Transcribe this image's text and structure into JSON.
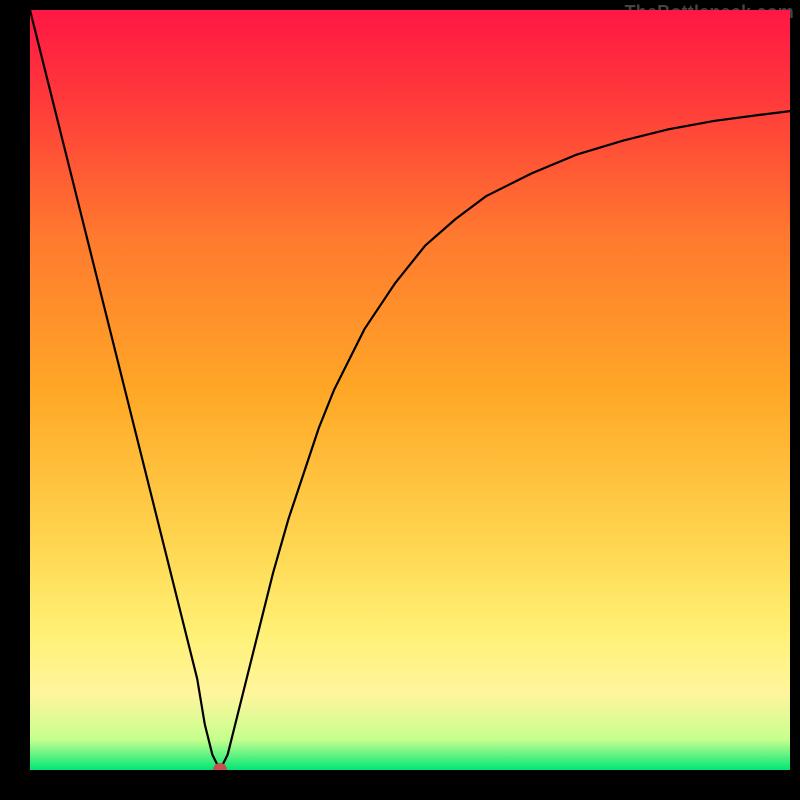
{
  "watermark": "TheBottleneck.com",
  "chart_data": {
    "type": "line",
    "title": "",
    "xlabel": "",
    "ylabel": "",
    "xlim": [
      0,
      100
    ],
    "ylim": [
      0,
      100
    ],
    "x": [
      0,
      2,
      4,
      6,
      8,
      10,
      12,
      14,
      16,
      18,
      20,
      22,
      23,
      24,
      25,
      26,
      28,
      30,
      32,
      34,
      36,
      38,
      40,
      44,
      48,
      52,
      56,
      60,
      66,
      72,
      78,
      84,
      90,
      96,
      100
    ],
    "values": [
      100,
      92,
      84,
      76,
      68,
      60,
      52,
      44,
      36,
      28,
      20,
      12,
      6,
      2,
      0,
      2,
      10,
      18,
      26,
      33,
      39,
      45,
      50,
      58,
      64,
      69,
      72.5,
      75.5,
      78.5,
      81,
      82.8,
      84.3,
      85.4,
      86.2,
      86.7
    ],
    "marker": {
      "x": 25,
      "y": 0,
      "color": "#c94f4f"
    },
    "gradient_stops": [
      {
        "offset": 0.0,
        "color": "#ff1744"
      },
      {
        "offset": 0.12,
        "color": "#ff3a3a"
      },
      {
        "offset": 0.3,
        "color": "#ff7a2f"
      },
      {
        "offset": 0.5,
        "color": "#ffa726"
      },
      {
        "offset": 0.7,
        "color": "#ffd54f"
      },
      {
        "offset": 0.82,
        "color": "#fff176"
      },
      {
        "offset": 0.9,
        "color": "#fff59d"
      },
      {
        "offset": 0.96,
        "color": "#c6ff8e"
      },
      {
        "offset": 1.0,
        "color": "#00e676"
      }
    ],
    "curve_color": "#000000",
    "curve_width": 2.2
  }
}
